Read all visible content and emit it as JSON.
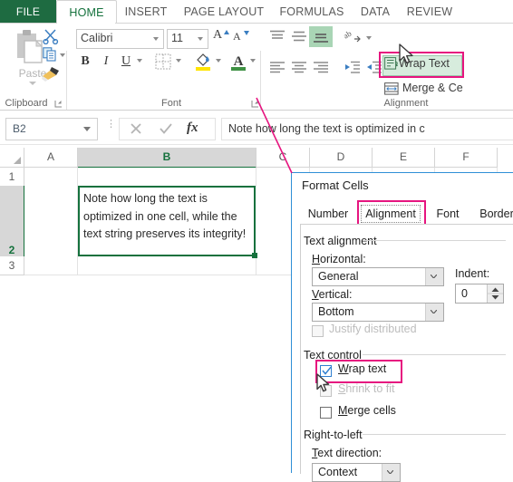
{
  "app": {
    "name": "Microsoft Excel",
    "accent_green": "#1e6b41",
    "highlight_magenta": "#e6157f",
    "selection_green": "#15713d"
  },
  "ribbon": {
    "tabs": [
      {
        "id": "file",
        "label": "FILE"
      },
      {
        "id": "home",
        "label": "HOME"
      },
      {
        "id": "insert",
        "label": "INSERT"
      },
      {
        "id": "page_layout",
        "label": "PAGE LAYOUT"
      },
      {
        "id": "formulas",
        "label": "FORMULAS"
      },
      {
        "id": "data",
        "label": "DATA"
      },
      {
        "id": "review",
        "label": "REVIEW"
      }
    ],
    "active_tab": "HOME",
    "groups": {
      "clipboard": {
        "label": "Clipboard",
        "paste_label": "Paste",
        "cut_icon": "scissors-icon",
        "copy_icon": "copy-icon",
        "format_painter_icon": "format-painter-icon",
        "launcher_icon": "dialog-launcher-icon"
      },
      "font": {
        "label": "Font",
        "font_name": "Calibri",
        "font_size": "11",
        "grow_font": "A",
        "shrink_font": "A",
        "bold": "B",
        "italic": "I",
        "underline": "U",
        "borders_icon": "borders-icon",
        "fill_color_icon": "fill-color-icon",
        "font_color_icon": "font-color-icon",
        "launcher_icon": "dialog-launcher-icon"
      },
      "alignment": {
        "label": "Alignment",
        "top_align_icon": "align-top-icon",
        "middle_align_icon": "align-middle-icon",
        "bottom_align_icon": "align-bottom-icon",
        "orientation_icon": "text-orientation-icon",
        "align_left_icon": "align-left-icon",
        "align_center_icon": "align-center-icon",
        "align_right_icon": "align-right-icon",
        "decrease_indent_icon": "decrease-indent-icon",
        "increase_indent_icon": "increase-indent-icon",
        "wrap_text_label": "Wrap Text",
        "merge_center_label": "Merge & Ce",
        "bottom_align_active": true,
        "wrap_text_active": true,
        "wrap_text_highlighted": true
      }
    }
  },
  "formula_bar": {
    "name_box_value": "B2",
    "cancel_icon": "cancel-x-icon",
    "accept_icon": "accept-check-icon",
    "function_icon": "fx",
    "value": "Note how long the text is optimized in c"
  },
  "sheet": {
    "column_headers": [
      "A",
      "B",
      "C",
      "D",
      "E",
      "F"
    ],
    "row_headers": [
      "1",
      "2",
      "3"
    ],
    "selected_cell": "B2",
    "selected_column": "B",
    "selected_row": "2",
    "cell_b2_text": "Note how long the text is optimized in one cell, while the text string preserves its integrity!"
  },
  "dialog": {
    "title": "Format Cells",
    "tabs": [
      {
        "id": "number",
        "label": "Number"
      },
      {
        "id": "alignment",
        "label": "Alignment"
      },
      {
        "id": "font",
        "label": "Font"
      },
      {
        "id": "border",
        "label": "Border"
      }
    ],
    "active_tab": "Alignment",
    "active_tab_highlighted": true,
    "text_alignment": {
      "section_label": "Text alignment",
      "horizontal_label": "Horizontal:",
      "horizontal_value": "General",
      "indent_label": "Indent:",
      "indent_value": "0",
      "vertical_label": "Vertical:",
      "vertical_value": "Bottom",
      "justify_distributed_label": "Justify distributed",
      "justify_distributed_checked": false,
      "justify_distributed_disabled": true
    },
    "text_control": {
      "section_label": "Text control",
      "wrap_text_label": "Wrap text",
      "wrap_text_checked": true,
      "wrap_text_highlighted": true,
      "shrink_to_fit_label": "Shrink to fit",
      "shrink_to_fit_checked": false,
      "shrink_to_fit_disabled": true,
      "merge_cells_label": "Merge cells",
      "merge_cells_checked": false
    },
    "right_to_left": {
      "section_label": "Right-to-left",
      "text_direction_label": "Text direction:",
      "text_direction_value": "Context"
    }
  },
  "annotations": {
    "arrow_color": "#e6157f",
    "arrow_description": "pink-arrow-from-font-launcher-to-format-cells-dialog",
    "cursor_ribbon": "mouse-pointer-on-wrap-text-button",
    "cursor_dialog": "mouse-pointer-on-wrap-text-checkbox"
  }
}
